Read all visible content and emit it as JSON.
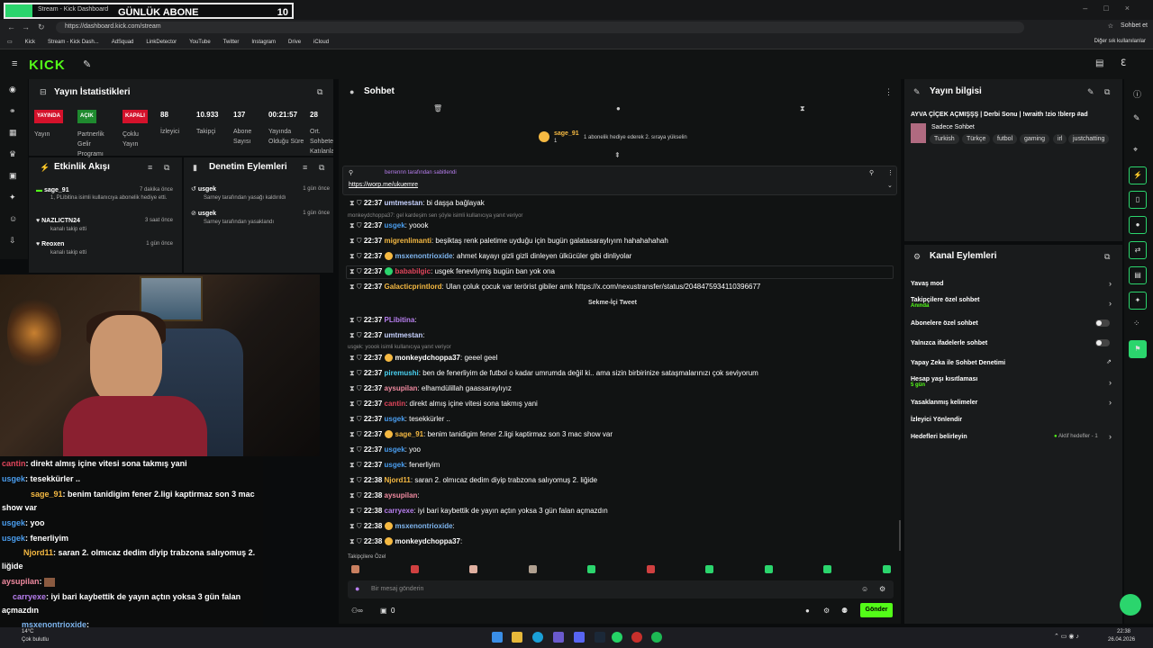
{
  "browser": {
    "tab_title": "Stream - Kick Dashboard",
    "overlay_text": "GÜNLÜK ABONE",
    "overlay_count": "10",
    "url": "https://dashboard.kick.com/stream",
    "profile_label": "Sohbet et",
    "bookmarks": [
      "Kick",
      "Stream - Kick Dash...",
      "AdSquad",
      "LinkDetector",
      "YouTube",
      "Twitter",
      "Instagram",
      "Drive",
      "iCloud"
    ],
    "other_bookmarks": "Diğer sık kullanılanlar"
  },
  "stats": {
    "title": "Yayın İstatistikleri",
    "items": [
      {
        "badge": "YAYINDA",
        "label": "Yayın",
        "color": "#d4122b"
      },
      {
        "badge": "AÇIK",
        "label": "Partnerlik Gelir Programı",
        "color": "#1f8a2f"
      },
      {
        "badge": "KAPALI",
        "label": "Çoklu Yayın",
        "color": "#d4122b"
      },
      {
        "value": "88",
        "label": "İzleyici"
      },
      {
        "value": "10.933",
        "label": "Takipçi"
      },
      {
        "value": "137",
        "label": "Abone Sayısı"
      },
      {
        "value": "00:21:57",
        "label": "Yayında Olduğu Süre"
      },
      {
        "value": "28",
        "label": "Ort. Sohbete Katılanlar"
      }
    ]
  },
  "events": {
    "title": "Etkinlik Akışı",
    "items": [
      {
        "user": "sage_91",
        "detail": "1, PLibitina isimli kullanıcıya abonelik hediye etti.",
        "time": "7 dakika önce"
      },
      {
        "user": "NAZLICTN24",
        "detail": "kanalı takip etti",
        "time": "3 saat önce"
      },
      {
        "user": "Reoxen",
        "detail": "kanalı takip etti",
        "time": "1 gün önce"
      }
    ]
  },
  "moderation": {
    "title": "Denetim Eylemleri",
    "items": [
      {
        "user": "usgek",
        "detail": "Sarney tarafından yasağı kaldırıldı",
        "time": "1 gün önce"
      },
      {
        "user": "usgek",
        "detail": "Sarney tarafından yasaklandı",
        "time": "1 gün önce"
      }
    ]
  },
  "overlay_chat": [
    {
      "user": "cantin",
      "text": ": direkt almış içine vitesi sona takmış yani",
      "color": "#e0455b"
    },
    {
      "user": "usgek",
      "text": ": tesekkürler ..",
      "color": "#4a9ef0"
    },
    {
      "user": "sage_91",
      "text": ": benim tanidigim fener 2.ligi kaptirmaz son 3 mac show var",
      "color": "#f5b942"
    },
    {
      "user": "usgek",
      "text": ": yoo",
      "color": "#4a9ef0"
    },
    {
      "user": "usgek",
      "text": ": fenerliyim",
      "color": "#4a9ef0"
    },
    {
      "user": "Njord11",
      "text": ": saran 2. olmıcaz dedim diyip trabzona salıyomuş 2. liğide",
      "color": "#f5b942"
    },
    {
      "user": "aysupilan",
      "text": ": ",
      "color": "#f08aa0"
    },
    {
      "user": "carryexe",
      "text": ": iyi bari kaybettik de yayın açtın yoksa 3 gün falan açmazdın",
      "color": "#b87ff0"
    },
    {
      "user": "msxenontrioxide",
      "text": ": ",
      "color": "#7fb6f0"
    }
  ],
  "chat": {
    "title": "Sohbet",
    "gift_notice": "1 abonelik hediye ederek 2. sıraya yükselin",
    "top_gifter": "sage_91",
    "top_gifter_count": "1",
    "pinned_by": "berrennn tarafından sabitlendi",
    "pinned_link": "https://worp.me/ukuemre",
    "tweet_label": "Sekme-İçi Tweet",
    "messages": [
      {
        "time": "22:37",
        "user": "umtmestan",
        "text": ": bi daşşa bağlayak",
        "color": "#c7d2ff"
      },
      {
        "time": "22:37",
        "user": "usgek",
        "text": ": yoook",
        "color": "#4a9ef0"
      },
      {
        "time": "22:37",
        "user": "migrenlimanti",
        "text": ": beşiktaş renk paletime uyduğu için bugün galatasaraylıyım hahahahahah",
        "color": "#f5b942"
      },
      {
        "time": "22:37",
        "user": "msxenontrioxide",
        "text": ": ahmet kayayı gizli gizli dinleyen ülkücüler gibi dinliyolar",
        "color": "#7fb6f0"
      },
      {
        "time": "22:37",
        "user": "bababilgic",
        "text": ": usgek fenevliymiş bugün ban yok ona",
        "color": "#e0455b"
      },
      {
        "time": "22:37",
        "user": "Galacticprintlord",
        "text": ": Ulan çoluk çocuk var terörist gibiler amk https://x.com/nexustransfer/status/2048475934110396677",
        "color": "#f5b942"
      },
      {
        "time": "22:37",
        "user": "PLibitina",
        "text": ":",
        "color": "#b87ff0"
      },
      {
        "time": "22:37",
        "user": "umtmestan",
        "text": ":",
        "color": "#c7d2ff"
      },
      {
        "time": "22:37",
        "user": "monkeydchoppa37",
        "text": ": geeel geel",
        "color": "#ffffff"
      },
      {
        "time": "22:37",
        "user": "piremushi",
        "text": ": ben de fenerliyim de futbol o kadar umrumda değil ki.. ama sizin birbirinize sataşmalarınızı çok seviyorum",
        "color": "#4ad0f0"
      },
      {
        "time": "22:37",
        "user": "aysupilan",
        "text": ": elhamdülillah gaassaraylıyız",
        "color": "#f08aa0"
      },
      {
        "time": "22:37",
        "user": "cantin",
        "text": ": direkt almış içine vitesi sona takmış yani",
        "color": "#e0455b"
      },
      {
        "time": "22:37",
        "user": "usgek",
        "text": ": tesekkürler ..",
        "color": "#4a9ef0"
      },
      {
        "time": "22:37",
        "user": "sage_91",
        "text": ": benim tanidigim fener 2.ligi kaptirmaz son 3 mac show var",
        "color": "#f5b942"
      },
      {
        "time": "22:37",
        "user": "usgek",
        "text": ": yoo",
        "color": "#4a9ef0"
      },
      {
        "time": "22:37",
        "user": "usgek",
        "text": ": fenerliyim",
        "color": "#4a9ef0"
      },
      {
        "time": "22:38",
        "user": "Njord11",
        "text": ": saran 2. olmıcaz dedim diyip trabzona salıyomuş 2. liğide",
        "color": "#f5b942"
      },
      {
        "time": "22:38",
        "user": "aysupilan",
        "text": ":",
        "color": "#f08aa0"
      },
      {
        "time": "22:38",
        "user": "carryexe",
        "text": ": iyi bari kaybettik de yayın açtın yoksa 3 gün falan açmazdın",
        "color": "#b87ff0"
      },
      {
        "time": "22:38",
        "user": "msxenontrioxide",
        "text": ":",
        "color": "#7fb6f0"
      },
      {
        "time": "22:38",
        "user": "monkeydchoppa37",
        "text": ":",
        "color": "#ffffff"
      }
    ],
    "replies": [
      "monkeydchoppa37: gel kardeşim sen şöyle isimli kullanıcıya yanıt veriyor",
      "usgek: yoook isimli kullanıcıya yanıt veriyor"
    ],
    "followers_label": "Takipçilere Özel",
    "input_placeholder": "Bir mesaj gönderin",
    "viewer_count": "0",
    "send_label": "Gönder"
  },
  "info": {
    "title": "Yayın bilgisi",
    "stream_title": "AYVA ÇİÇEK AÇMIŞŞŞ | Derbi Sonu | !wraith !zio !blerp #ad",
    "category": "Sadece Sohbet",
    "tags": [
      "Turkish",
      "Türkçe",
      "futbol",
      "gaming",
      "irl",
      "justchatting"
    ]
  },
  "actions": {
    "title": "Kanal Eylemleri",
    "items": [
      {
        "label": "Yavaş mod",
        "sub": "",
        "control": "chevron"
      },
      {
        "label": "Takipçilere özel sohbet",
        "sub": "Anında",
        "control": "chevron"
      },
      {
        "label": "Abonelere özel sohbet",
        "sub": "",
        "control": "toggle"
      },
      {
        "label": "Yalnızca ifadelerle sohbet",
        "sub": "",
        "control": "toggle"
      },
      {
        "label": "Yapay Zeka ile Sohbet Denetimi",
        "sub": "",
        "control": "external"
      },
      {
        "label": "Hesap yaşı kısıtlaması",
        "sub": "5 gün",
        "control": "chevron"
      },
      {
        "label": "Yasaklanmış kelimeler",
        "sub": "",
        "control": "chevron"
      },
      {
        "label": "İzleyici Yönlendir",
        "sub": "",
        "control": "none"
      },
      {
        "label": "Hedefleri belirleyin",
        "sub": "",
        "control": "chevron"
      }
    ],
    "goals_status": "Aktif hedefler - 1"
  },
  "taskbar": {
    "weather_temp": "14°C",
    "weather_desc": "Çok bulutlu",
    "time": "22:38",
    "date": "26.04.2026"
  }
}
